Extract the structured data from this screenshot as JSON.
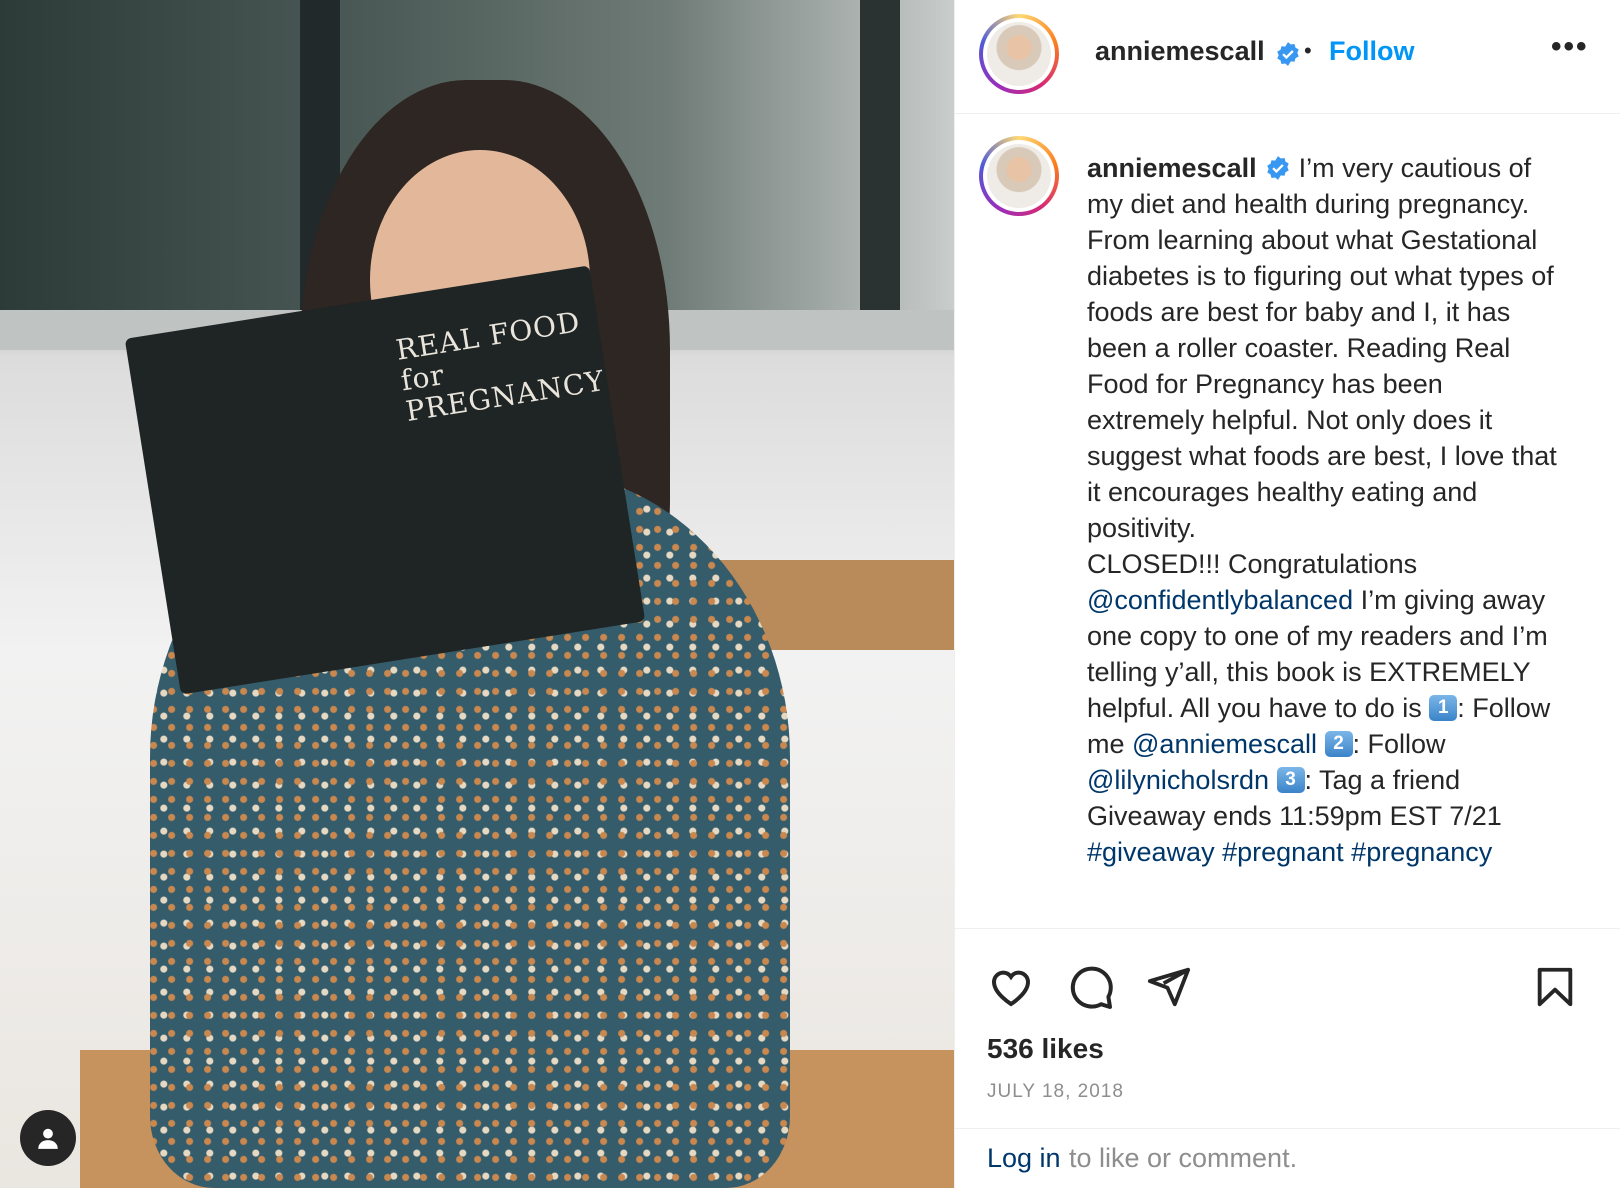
{
  "post": {
    "image_alt": "Woman reading Real Food for Pregnancy book",
    "book_cover_title": "REAL FOOD for PREGNANCY"
  },
  "header": {
    "username": "anniemescall",
    "separator": "•",
    "follow_label": "Follow",
    "more_label": "•••"
  },
  "caption": {
    "username": "anniemescall",
    "text_1": "I’m very cautious of my diet and health during pregnancy. From learning about what Gestational diabetes is to figuring out what types of foods are best for baby and I, it has been a roller coaster. Reading Real Food for Pregnancy has been extremely helpful. Not only does it suggest what foods are best, I love that it encourages healthy eating and positivity.",
    "text_2": "CLOSED!!! Congratulations",
    "mention_1": "@confidentlybalanced",
    "text_3": " I’m giving away one copy to one of my readers and I’m telling y’all, this book is EXTREMELY helpful. All you have to do is ",
    "key_1": "1",
    "text_4": ": Follow me ",
    "mention_2": "@anniemescall",
    "key_2": "2",
    "text_5": ": Follow ",
    "mention_3": "@lilynicholsrdn",
    "key_3": "3",
    "text_6": ": Tag a friend",
    "text_7": "Giveaway ends 11:59pm EST 7/21",
    "hashtags": "#giveaway #pregnant #pregnancy"
  },
  "actions": {
    "likes": "536 likes",
    "date": "JULY 18, 2018"
  },
  "login": {
    "link_label": "Log in",
    "rest_label": "to like or comment."
  },
  "colors": {
    "accent": "#0095f6",
    "mention": "#00376b",
    "muted": "#8e8e8e"
  },
  "icons": [
    "verified-badge-icon",
    "more-options-icon",
    "heart-icon",
    "comment-icon",
    "share-icon",
    "bookmark-icon",
    "user-icon"
  ]
}
